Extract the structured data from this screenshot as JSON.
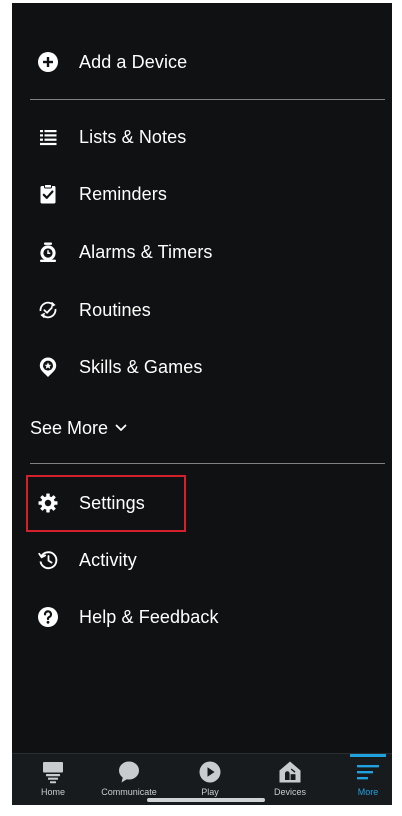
{
  "menu": {
    "add_device": "Add a Device",
    "lists_notes": "Lists & Notes",
    "reminders": "Reminders",
    "alarms_timers": "Alarms & Timers",
    "routines": "Routines",
    "skills_games": "Skills & Games",
    "see_more": "See More",
    "settings": "Settings",
    "activity": "Activity",
    "help_feedback": "Help & Feedback"
  },
  "tabs": [
    {
      "label": "Home",
      "icon": "home-icon"
    },
    {
      "label": "Communicate",
      "icon": "chat-bubble-icon"
    },
    {
      "label": "Play",
      "icon": "play-icon"
    },
    {
      "label": "Devices",
      "icon": "devices-house-icon"
    },
    {
      "label": "More",
      "icon": "hamburger-menu-icon",
      "active": true
    }
  ],
  "colors": {
    "background": "#0f1112",
    "text": "#ffffff",
    "divider": "#7d8184",
    "highlight": "#d4202c",
    "accent": "#1fa3e0",
    "tabbar": "#181b1d"
  }
}
